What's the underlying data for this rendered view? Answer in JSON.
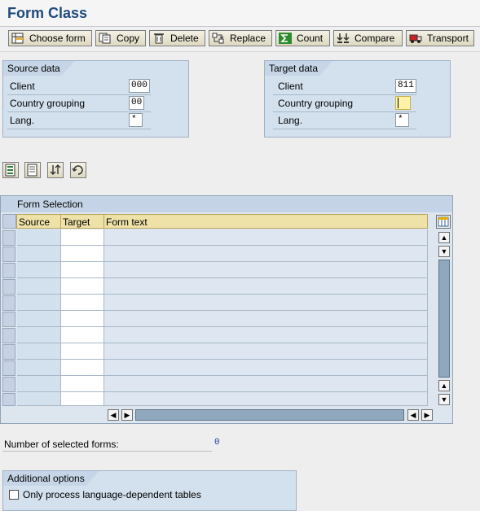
{
  "title": "Form Class",
  "toolbar": {
    "choose_form": "Choose form",
    "copy": "Copy",
    "delete": "Delete",
    "replace": "Replace",
    "count": "Count",
    "compare": "Compare",
    "transport": "Transport"
  },
  "source": {
    "heading": "Source data",
    "client_label": "Client",
    "client_value": "000",
    "country_label": "Country grouping",
    "country_value": "00",
    "lang_label": "Lang.",
    "lang_value": "*"
  },
  "target": {
    "heading": "Target data",
    "client_label": "Client",
    "client_value": "811",
    "country_label": "Country grouping",
    "country_value": "",
    "lang_label": "Lang.",
    "lang_value": "*"
  },
  "table": {
    "title": "Form Selection",
    "columns": [
      "Source",
      "Target",
      "Form text"
    ],
    "visible_rows": 11
  },
  "summary": {
    "selected_label": "Number of selected forms:",
    "selected_value": "0"
  },
  "options": {
    "heading": "Additional options",
    "language_checkbox_label": "Only process language-dependent tables",
    "language_checkbox_checked": false
  },
  "colors": {
    "title": "#1f4b7c",
    "group_bg": "#d3e0ed",
    "table_header": "#efe2a8",
    "input_highlight": "#fff3a8"
  }
}
